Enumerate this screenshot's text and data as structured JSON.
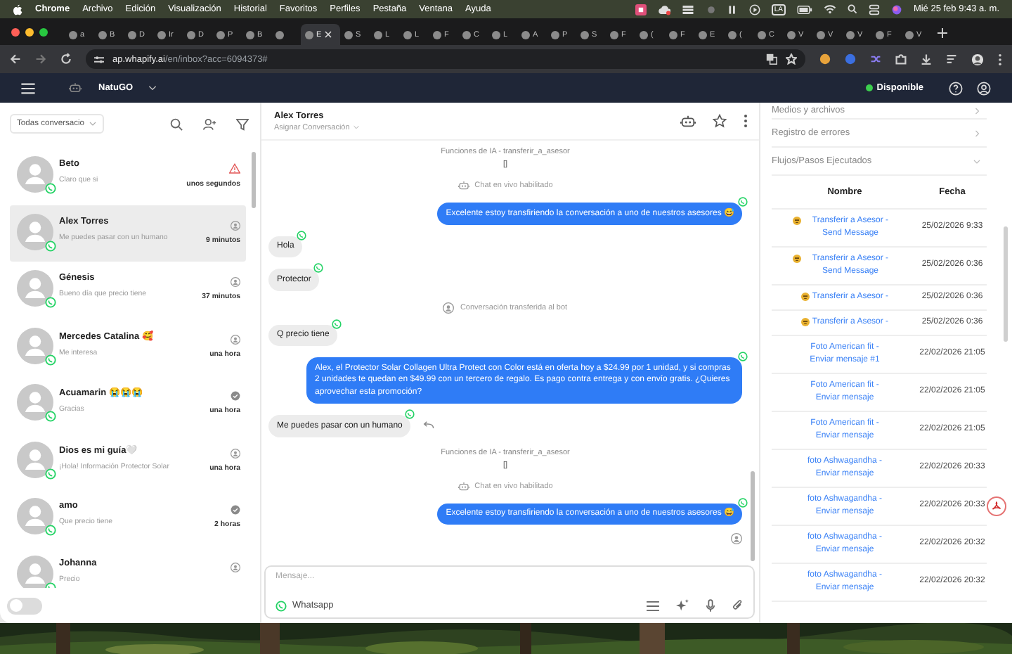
{
  "menu_bar": {
    "app": "Chrome",
    "items": [
      "Archivo",
      "Edición",
      "Visualización",
      "Historial",
      "Favoritos",
      "Perfiles",
      "Pestaña",
      "Ventana",
      "Ayuda"
    ],
    "input_source": "LA",
    "clock": "Mié 25 feb  9:43 a. m."
  },
  "browser": {
    "tabs": [
      {
        "title": "a",
        "selected": false
      },
      {
        "title": "B",
        "selected": false
      },
      {
        "title": "D",
        "selected": false
      },
      {
        "title": "Ir",
        "selected": false
      },
      {
        "title": "D",
        "selected": false
      },
      {
        "title": "P",
        "selected": false
      },
      {
        "title": "B",
        "selected": false
      },
      {
        "selected": false
      },
      {
        "title": "E",
        "selected": true
      },
      {
        "title": "S",
        "selected": false
      },
      {
        "title": "L",
        "selected": false
      },
      {
        "title": "L",
        "selected": false
      },
      {
        "title": "F",
        "selected": false
      },
      {
        "title": "C",
        "selected": false
      },
      {
        "title": "L",
        "selected": false
      },
      {
        "title": "A",
        "selected": false
      },
      {
        "title": "P",
        "selected": false
      },
      {
        "title": "S",
        "selected": false
      },
      {
        "title": "F",
        "selected": false
      },
      {
        "title": "(",
        "selected": false
      },
      {
        "title": "F",
        "selected": false
      },
      {
        "title": "E",
        "selected": false
      },
      {
        "title": "(",
        "selected": false
      },
      {
        "title": "C",
        "selected": false
      },
      {
        "title": "V",
        "selected": false
      },
      {
        "title": "V",
        "selected": false
      },
      {
        "title": "V",
        "selected": false
      },
      {
        "title": "F",
        "selected": false
      },
      {
        "title": "V",
        "selected": false
      }
    ],
    "address": {
      "host": "ap.whapify.ai",
      "path": "/en/inbox?acc=6094373#"
    }
  },
  "app_header": {
    "workspace": "NatuGO",
    "status": {
      "label": "Disponible",
      "online": true
    }
  },
  "conversations": {
    "filter": "Todas conversacio",
    "items": [
      {
        "name": "Beto",
        "preview": "Claro que si",
        "kind": "warning",
        "time": "unos segundos",
        "selected": false
      },
      {
        "name": "Alex Torres",
        "preview": "Me puedes pasar con un humano",
        "kind": "person",
        "time": "9 minutos",
        "selected": true
      },
      {
        "name": "Génesis",
        "preview": "Bueno día que precio tiene",
        "kind": "person",
        "time": "37 minutos",
        "selected": false
      },
      {
        "name": "Mercedes Catalina 🥰",
        "preview": "Me interesa",
        "kind": "person",
        "time": "una hora",
        "selected": false
      },
      {
        "name": "Acuamarin 😭😭😭",
        "preview": "Gracias",
        "kind": "check",
        "time": "una hora",
        "selected": false
      },
      {
        "name": "Dios es mi guía🤍",
        "preview": "¡Hola! Información Protector Solar",
        "kind": "person",
        "time": "una hora",
        "selected": false
      },
      {
        "name": "amo",
        "preview": "Que precio tiene",
        "kind": "check",
        "time": "2 horas",
        "selected": false
      },
      {
        "name": "Johanna",
        "preview": "Precio",
        "kind": "person",
        "selected": false
      }
    ],
    "auto_toggle": {
      "on": false
    }
  },
  "chat": {
    "contact": "Alex Torres",
    "assign": "Asignar Conversación",
    "messages": [
      {
        "kind": "function",
        "text": "Funciones de IA - transferir_a_asesor",
        "detail": "[]"
      },
      {
        "kind": "bot_event",
        "text": "Chat en vivo habilitado"
      },
      {
        "kind": "out",
        "text": "Excelente estoy transfiriendo la conversación a uno de nuestros asesores 😅"
      },
      {
        "kind": "in",
        "text": "Hola",
        "reply": false
      },
      {
        "kind": "in",
        "text": "Protector",
        "reply": false
      },
      {
        "kind": "person_event",
        "text": "Conversación transferida al bot"
      },
      {
        "kind": "in",
        "text": "Q precio tiene",
        "reply": false
      },
      {
        "kind": "out",
        "text": "Alex, el Protector Solar Collagen Ultra Protect con Color está en oferta hoy a $24.99 por 1 unidad, y si compras 2 unidades te quedan en $49.99 con un tercero de regalo. Es pago contra entrega y con envío gratis. ¿Quieres aprovechar esta promoción?"
      },
      {
        "kind": "in",
        "text": "Me puedes pasar con un humano",
        "reply": true
      },
      {
        "kind": "function",
        "text": "Funciones de IA - transferir_a_asesor",
        "detail": "[]"
      },
      {
        "kind": "bot_event",
        "text": "Chat en vivo habilitado"
      },
      {
        "kind": "out",
        "text": "Excelente estoy transfiriendo la conversación a uno de nuestros asesores 😅"
      },
      {
        "kind": "agent"
      }
    ],
    "composer": {
      "placeholder": "Mensaje...",
      "channel": "Whatsapp"
    }
  },
  "details": {
    "sections": [
      {
        "title": "Medios y archivos",
        "expanded": false
      },
      {
        "title": "Registro de errores",
        "expanded": false
      },
      {
        "title": "Flujos/Pasos Ejecutados",
        "expanded": true
      }
    ],
    "table": {
      "columns": [
        "Nombre",
        "Fecha"
      ],
      "rows": [
        {
          "kind": "bot",
          "name": "Transferir a Asesor - Send Message",
          "date": "25/02/2026 9:33"
        },
        {
          "kind": "bot",
          "name": "Transferir a Asesor - Send Message",
          "date": "25/02/2026 0:36"
        },
        {
          "kind": "bot",
          "name": "Transferir a Asesor -",
          "date": "25/02/2026 0:36"
        },
        {
          "kind": "bot",
          "name": "Transferir a Asesor -",
          "date": "25/02/2026 0:36"
        },
        {
          "kind": "plain",
          "name": "Foto American fit - Enviar mensaje #1",
          "date": "22/02/2026 21:05"
        },
        {
          "kind": "plain",
          "name": "Foto American fit - Enviar mensaje",
          "date": "22/02/2026 21:05"
        },
        {
          "kind": "plain",
          "name": "Foto American fit - Enviar mensaje",
          "date": "22/02/2026 21:05"
        },
        {
          "kind": "plain",
          "name": "foto Ashwagandha - Enviar mensaje",
          "date": "22/02/2026 20:33"
        },
        {
          "kind": "plain",
          "name": "foto Ashwagandha - Enviar mensaje",
          "date": "22/02/2026 20:33"
        },
        {
          "kind": "plain",
          "name": "foto Ashwagandha - Enviar mensaje",
          "date": "22/02/2026 20:32"
        },
        {
          "kind": "plain",
          "name": "foto Ashwagandha - Enviar mensaje",
          "date": "22/02/2026 20:32"
        }
      ]
    }
  }
}
